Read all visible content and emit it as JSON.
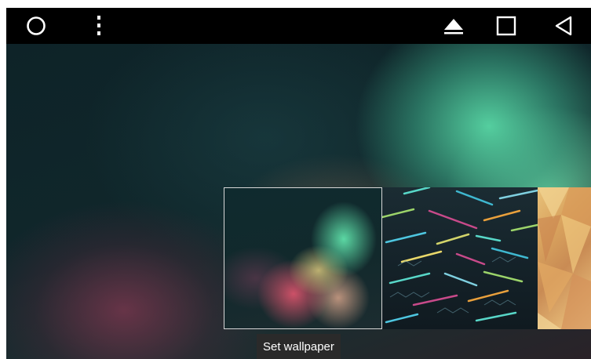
{
  "navbar": {
    "icons": {
      "home": "circle-icon",
      "menu": "overflow-menu-icon",
      "eject": "eject-icon",
      "recents": "square-icon",
      "back": "back-triangle-icon"
    },
    "icon_color": "#ffffff",
    "background": "#000000"
  },
  "wallpaper_picker": {
    "thumbnails": [
      {
        "name": "nebula",
        "selected": true
      },
      {
        "name": "light-streaks",
        "selected": false
      },
      {
        "name": "polygon-gold",
        "selected": false
      }
    ],
    "set_wallpaper_label": "Set wallpaper"
  },
  "colors": {
    "teal_glow": "#58d7a5",
    "magenta_glow": "#e1556e",
    "tooltip_bg": "#2a2a2a"
  }
}
